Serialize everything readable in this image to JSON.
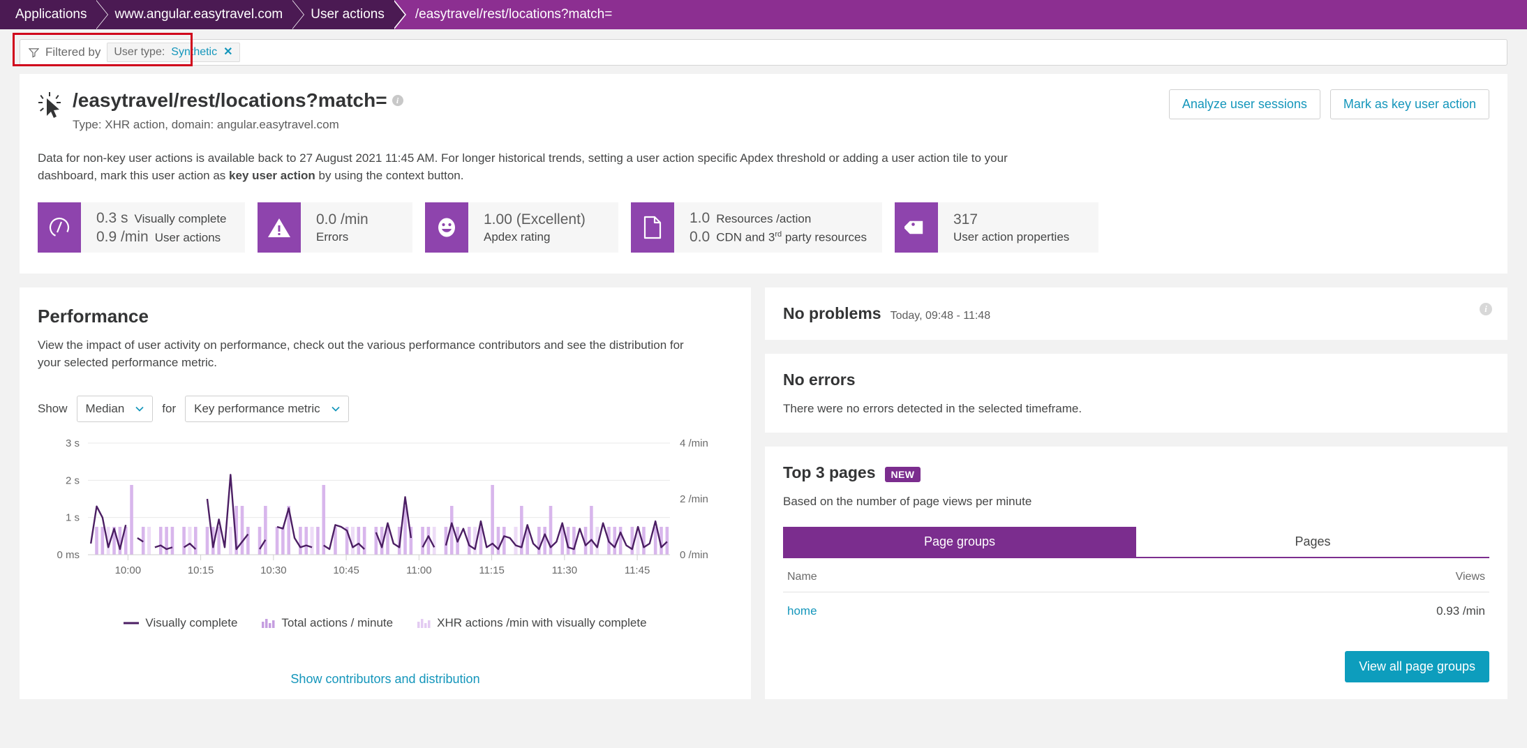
{
  "breadcrumb": {
    "items": [
      {
        "label": "Applications"
      },
      {
        "label": "www.angular.easytravel.com"
      },
      {
        "label": "User actions"
      },
      {
        "label": "/easytravel/rest/locations?match="
      }
    ]
  },
  "filter": {
    "filtered_by_label": "Filtered by",
    "chip_key": "User type:",
    "chip_value": "Synthetic",
    "chip_remove": "✕",
    "funnel_icon": "funnel-icon"
  },
  "header": {
    "icon": "cursor-click-icon",
    "title": "/easytravel/rest/locations?match=",
    "info_icon": "info-icon",
    "subtitle": "Type: XHR action, domain: angular.easytravel.com",
    "actions": [
      {
        "label": "Analyze user sessions",
        "name": "analyze-user-sessions-button"
      },
      {
        "label": "Mark as key user action",
        "name": "mark-as-key-user-action-button"
      }
    ],
    "info_paragraph_1": "Data for non-key user actions is available back to 27 August 2021 11:45 AM. For longer historical trends, setting a user action specific Apdex threshold or adding a user action tile to your dashboard, mark this user action as ",
    "info_paragraph_bold": "key user action",
    "info_paragraph_2": " by using the context button."
  },
  "tiles": [
    {
      "icon": "speedometer-icon",
      "lines": [
        {
          "value": "0.3 s",
          "label": "Visually complete"
        },
        {
          "value": "0.9 /min",
          "label": "User actions"
        }
      ]
    },
    {
      "icon": "warning-triangle-icon",
      "lines": [
        {
          "value": "0.0 /min",
          "label": ""
        },
        {
          "value": "",
          "label": "Errors"
        }
      ]
    },
    {
      "icon": "smiley-icon",
      "lines": [
        {
          "value": "1.00 (Excellent)",
          "label": ""
        },
        {
          "value": "",
          "label": "Apdex rating"
        }
      ]
    },
    {
      "icon": "document-icon",
      "lines": [
        {
          "value": "1.0",
          "label": "Resources /action"
        },
        {
          "value": "0.0",
          "label": "CDN and 3rd party resources"
        }
      ]
    },
    {
      "icon": "tag-icon",
      "lines": [
        {
          "value": "317",
          "label": ""
        },
        {
          "value": "",
          "label": "User action properties"
        }
      ]
    }
  ],
  "performance": {
    "title": "Performance",
    "description": "View the impact of user activity on performance, check out the various performance contributors and see the distribution for your selected performance metric.",
    "show_label": "Show",
    "for_label": "for",
    "aggregation_value": "Median",
    "metric_value": "Key performance metric",
    "show_contributors_link": "Show contributors and distribution"
  },
  "chart_data": {
    "type": "line",
    "title": "Performance",
    "xlabel": "",
    "ylabel": "",
    "grid": true,
    "legend_position": "bottom",
    "x_ticks": [
      "10:00",
      "10:15",
      "10:30",
      "10:45",
      "11:00",
      "11:15",
      "11:30",
      "11:45"
    ],
    "y_left_ticks": [
      "0 ms",
      "1 s",
      "2 s",
      "3 s"
    ],
    "y_left_range": [
      0,
      3
    ],
    "y_left_unit": "s",
    "y_right_ticks": [
      "0 /min",
      "2 /min",
      "4 /min"
    ],
    "y_right_range": [
      0,
      4
    ],
    "y_right_unit": "/min",
    "legend": [
      {
        "name": "Visually complete",
        "marker": "line",
        "color": "#4b1e63"
      },
      {
        "name": "Total actions / minute",
        "marker": "bars",
        "color": "#c59ee0"
      },
      {
        "name": "XHR actions /min with visually complete",
        "marker": "bars",
        "color": "#e3cbf2"
      }
    ],
    "series": [
      {
        "name": "Total actions / minute",
        "type": "bar",
        "axis": "right",
        "color": "#d8b6ec",
        "values": [
          0,
          1,
          1,
          1,
          1,
          1,
          1,
          2.5,
          0,
          1,
          1,
          0,
          1,
          1,
          1,
          0,
          1,
          1,
          1,
          0,
          1,
          1,
          1,
          0,
          1,
          1.75,
          1.75,
          1,
          0,
          1,
          1.75,
          0,
          1,
          1,
          1.75,
          0,
          1,
          1,
          1,
          1,
          2.5,
          0,
          1,
          0,
          1,
          1,
          1,
          1,
          0,
          1,
          1,
          1,
          0,
          1,
          1.75,
          1,
          0,
          1,
          1,
          1,
          0,
          1,
          1.75,
          1,
          0,
          1,
          1,
          1,
          0,
          2.5,
          1,
          1,
          0,
          1,
          1.75,
          1,
          0,
          1,
          1,
          1.75,
          0,
          1,
          1,
          1,
          0,
          1,
          1.75,
          1,
          0,
          1,
          1,
          1,
          0,
          1,
          1,
          1,
          0,
          1,
          1,
          1
        ]
      },
      {
        "name": "Visually complete",
        "type": "line",
        "axis": "left",
        "color": "#4b1e63",
        "values": [
          0.3,
          1.3,
          1.0,
          0.2,
          0.7,
          0.15,
          0.8,
          null,
          0.45,
          0.35,
          null,
          0.2,
          0.25,
          0.15,
          0.2,
          null,
          0.2,
          0.3,
          0.15,
          null,
          1.5,
          0.2,
          0.95,
          0.2,
          2.15,
          0.15,
          0.35,
          0.55,
          null,
          0.15,
          0.4,
          null,
          0.75,
          0.7,
          1.25,
          0.45,
          0.2,
          0.25,
          0.2,
          null,
          0.25,
          0.15,
          0.8,
          0.75,
          0.65,
          0.2,
          0.3,
          0.15,
          null,
          0.6,
          0.2,
          0.85,
          0.3,
          0.2,
          1.55,
          0.45,
          null,
          0.2,
          0.5,
          0.2,
          null,
          0.25,
          0.85,
          0.35,
          0.7,
          0.25,
          0.15,
          0.9,
          0.2,
          0.3,
          0.15,
          0.5,
          0.45,
          0.25,
          0.2,
          0.8,
          0.3,
          0.15,
          0.55,
          0.2,
          0.35,
          0.85,
          0.2,
          0.15,
          0.7,
          0.25,
          0.4,
          0.2,
          0.85,
          0.35,
          0.2,
          0.6,
          0.25,
          0.15,
          0.75,
          0.2,
          0.3,
          0.9,
          0.2,
          0.35
        ]
      }
    ],
    "annotations": [
      {
        "x": "11:17",
        "y": 2.0,
        "kind": "marker-dash"
      },
      {
        "x": "10:48",
        "y": 1.3,
        "kind": "marker-dash"
      }
    ]
  },
  "problems": {
    "title": "No problems",
    "timeframe": "Today, 09:48 - 11:48",
    "info_icon": "info-icon"
  },
  "errors": {
    "title": "No errors",
    "text": "There were no errors detected in the selected timeframe."
  },
  "top_pages": {
    "title": "Top 3 pages",
    "badge": "NEW",
    "subtitle": "Based on the number of page views per minute",
    "tabs": [
      {
        "label": "Page groups",
        "active": true
      },
      {
        "label": "Pages",
        "active": false
      }
    ],
    "columns": [
      "Name",
      "Views"
    ],
    "rows": [
      {
        "name": "home",
        "views": "0.93 /min"
      }
    ],
    "view_all_button": "View all page groups"
  },
  "colors": {
    "brand_purple": "#4b1a53",
    "accent_purple": "#8c2f91",
    "tile_purple": "#8e44ad",
    "teal": "#1496bb",
    "teal_fill": "#0d9dbd",
    "bar_light": "#d8b6ec",
    "line_dark": "#4b1e63",
    "highlight_red": "#d0021b"
  }
}
